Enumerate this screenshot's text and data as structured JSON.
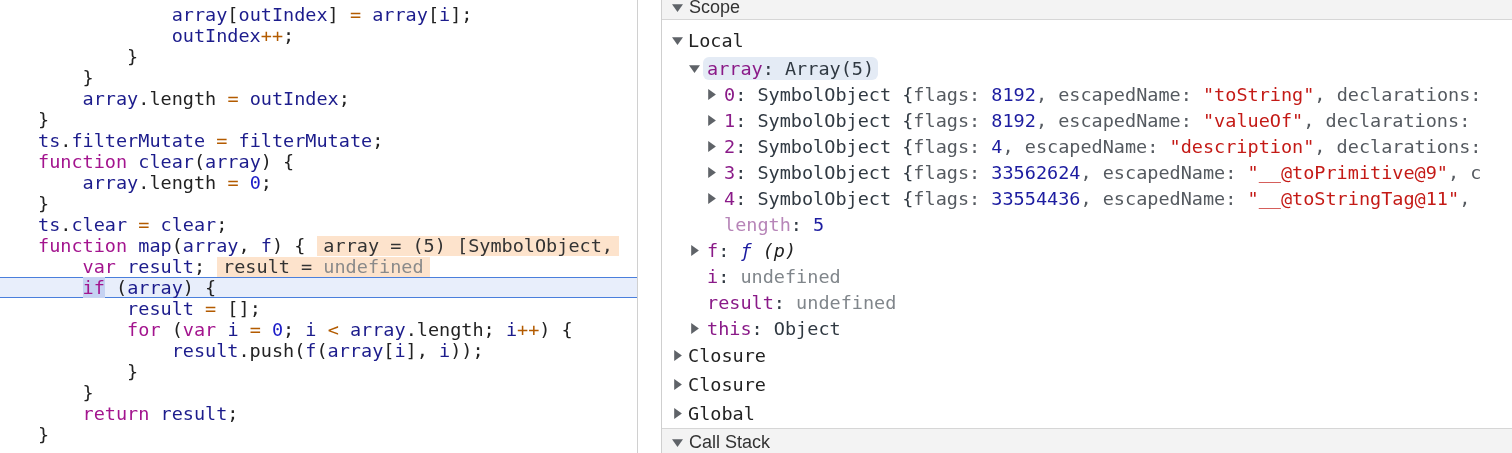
{
  "editor": {
    "lines": [
      {
        "current": false,
        "tokens": [
          {
            "kind": "var",
            "text": "            array"
          },
          {
            "kind": "punct",
            "text": "["
          },
          {
            "kind": "var",
            "text": "outIndex"
          },
          {
            "kind": "punct",
            "text": "] "
          },
          {
            "kind": "op",
            "text": "="
          },
          {
            "kind": "var",
            "text": " array"
          },
          {
            "kind": "punct",
            "text": "["
          },
          {
            "kind": "var",
            "text": "i"
          },
          {
            "kind": "punct",
            "text": "];"
          }
        ]
      },
      {
        "current": false,
        "tokens": [
          {
            "kind": "var",
            "text": "            outIndex"
          },
          {
            "kind": "op",
            "text": "++"
          },
          {
            "kind": "punct",
            "text": ";"
          }
        ]
      },
      {
        "current": false,
        "tokens": [
          {
            "kind": "punct",
            "text": "        }"
          }
        ]
      },
      {
        "current": false,
        "tokens": [
          {
            "kind": "punct",
            "text": "    }"
          }
        ]
      },
      {
        "current": false,
        "tokens": [
          {
            "kind": "var",
            "text": "    array"
          },
          {
            "kind": "punct",
            "text": ".length "
          },
          {
            "kind": "op",
            "text": "="
          },
          {
            "kind": "var",
            "text": " outIndex"
          },
          {
            "kind": "punct",
            "text": ";"
          }
        ]
      },
      {
        "current": false,
        "tokens": [
          {
            "kind": "punct",
            "text": "}"
          }
        ]
      },
      {
        "current": false,
        "tokens": [
          {
            "kind": "var",
            "text": "ts"
          },
          {
            "kind": "punct",
            "text": "."
          },
          {
            "kind": "var",
            "text": "filterMutate "
          },
          {
            "kind": "op",
            "text": "="
          },
          {
            "kind": "var",
            "text": " filterMutate"
          },
          {
            "kind": "punct",
            "text": ";"
          }
        ]
      },
      {
        "current": false,
        "tokens": [
          {
            "kind": "keyword",
            "text": "function"
          },
          {
            "kind": "var",
            "text": " clear"
          },
          {
            "kind": "punct",
            "text": "("
          },
          {
            "kind": "var",
            "text": "array"
          },
          {
            "kind": "punct",
            "text": ") {"
          }
        ]
      },
      {
        "current": false,
        "tokens": [
          {
            "kind": "var",
            "text": "    array"
          },
          {
            "kind": "punct",
            "text": ".length "
          },
          {
            "kind": "op",
            "text": "="
          },
          {
            "kind": "number",
            "text": " 0"
          },
          {
            "kind": "punct",
            "text": ";"
          }
        ]
      },
      {
        "current": false,
        "tokens": [
          {
            "kind": "punct",
            "text": "}"
          }
        ]
      },
      {
        "current": false,
        "tokens": [
          {
            "kind": "var",
            "text": "ts"
          },
          {
            "kind": "punct",
            "text": "."
          },
          {
            "kind": "var",
            "text": "clear "
          },
          {
            "kind": "op",
            "text": "="
          },
          {
            "kind": "var",
            "text": " clear"
          },
          {
            "kind": "punct",
            "text": ";"
          }
        ]
      },
      {
        "current": false,
        "tokens": [
          {
            "kind": "keyword",
            "text": "function"
          },
          {
            "kind": "var",
            "text": " map"
          },
          {
            "kind": "punct",
            "text": "("
          },
          {
            "kind": "var",
            "text": "array"
          },
          {
            "kind": "punct",
            "text": ", "
          },
          {
            "kind": "var",
            "text": "f"
          },
          {
            "kind": "punct",
            "text": ") {"
          }
        ],
        "annotation": [
          {
            "kind": "punct",
            "text": "array = (5) [SymbolObject,"
          }
        ]
      },
      {
        "current": false,
        "tokens": [
          {
            "kind": "keyword",
            "text": "    var"
          },
          {
            "kind": "var",
            "text": " result"
          },
          {
            "kind": "punct",
            "text": ";"
          }
        ],
        "annotation": [
          {
            "kind": "punct",
            "text": "result = "
          },
          {
            "kind": "undefined",
            "text": "undefined"
          }
        ]
      },
      {
        "current": true,
        "tokens": [
          {
            "kind": "paused_keyword",
            "text": "    if"
          },
          {
            "kind": "punct",
            "text": " ("
          },
          {
            "kind": "var",
            "text": "array"
          },
          {
            "kind": "punct",
            "text": ") {"
          }
        ]
      },
      {
        "current": false,
        "tokens": [
          {
            "kind": "var",
            "text": "        result "
          },
          {
            "kind": "op",
            "text": "="
          },
          {
            "kind": "punct",
            "text": " [];"
          }
        ]
      },
      {
        "current": false,
        "tokens": [
          {
            "kind": "keyword",
            "text": "        for"
          },
          {
            "kind": "punct",
            "text": " ("
          },
          {
            "kind": "keyword",
            "text": "var"
          },
          {
            "kind": "var",
            "text": " i "
          },
          {
            "kind": "op",
            "text": "="
          },
          {
            "kind": "number",
            "text": " 0"
          },
          {
            "kind": "punct",
            "text": "; "
          },
          {
            "kind": "var",
            "text": "i "
          },
          {
            "kind": "op",
            "text": "<"
          },
          {
            "kind": "var",
            "text": " array"
          },
          {
            "kind": "punct",
            "text": ".length; "
          },
          {
            "kind": "var",
            "text": "i"
          },
          {
            "kind": "op",
            "text": "++"
          },
          {
            "kind": "punct",
            "text": ") {"
          }
        ]
      },
      {
        "current": false,
        "tokens": [
          {
            "kind": "var",
            "text": "            result"
          },
          {
            "kind": "punct",
            "text": ".push("
          },
          {
            "kind": "var",
            "text": "f"
          },
          {
            "kind": "punct",
            "text": "("
          },
          {
            "kind": "var",
            "text": "array"
          },
          {
            "kind": "punct",
            "text": "["
          },
          {
            "kind": "var",
            "text": "i"
          },
          {
            "kind": "punct",
            "text": "], "
          },
          {
            "kind": "var",
            "text": "i"
          },
          {
            "kind": "punct",
            "text": "));"
          }
        ]
      },
      {
        "current": false,
        "tokens": [
          {
            "kind": "punct",
            "text": "        }"
          }
        ]
      },
      {
        "current": false,
        "tokens": [
          {
            "kind": "punct",
            "text": "    }"
          }
        ]
      },
      {
        "current": false,
        "tokens": [
          {
            "kind": "keyword",
            "text": "    return"
          },
          {
            "kind": "var",
            "text": " result"
          },
          {
            "kind": "punct",
            "text": ";"
          }
        ]
      },
      {
        "current": false,
        "tokens": [
          {
            "kind": "punct",
            "text": "}"
          }
        ]
      }
    ]
  },
  "scope_panel": {
    "title": "Scope",
    "expanded": true,
    "items": [
      {
        "kind": "scope",
        "name": "Local",
        "expanded": true,
        "children": [
          {
            "kind": "property",
            "name": "array",
            "value": [
              {
                "kind": "text",
                "text": ": Array(5)"
              }
            ],
            "expanded": true,
            "selected": true,
            "dimmed": false,
            "children": [
              {
                "kind": "property",
                "name": "0",
                "value": [
                  {
                    "kind": "text",
                    "text": ": SymbolObject {"
                  },
                  {
                    "kind": "key",
                    "text": "flags: "
                  },
                  {
                    "kind": "number",
                    "text": "8192"
                  },
                  {
                    "kind": "key",
                    "text": ", escapedName: "
                  },
                  {
                    "kind": "string",
                    "text": "\"toString\""
                  },
                  {
                    "kind": "key",
                    "text": ", declarations:"
                  }
                ],
                "expanded": false,
                "selected": false,
                "dimmed": false
              },
              {
                "kind": "property",
                "name": "1",
                "value": [
                  {
                    "kind": "text",
                    "text": ": SymbolObject {"
                  },
                  {
                    "kind": "key",
                    "text": "flags: "
                  },
                  {
                    "kind": "number",
                    "text": "8192"
                  },
                  {
                    "kind": "key",
                    "text": ", escapedName: "
                  },
                  {
                    "kind": "string",
                    "text": "\"valueOf\""
                  },
                  {
                    "kind": "key",
                    "text": ", declarations:"
                  }
                ],
                "expanded": false,
                "selected": false,
                "dimmed": false
              },
              {
                "kind": "property",
                "name": "2",
                "value": [
                  {
                    "kind": "text",
                    "text": ": SymbolObject {"
                  },
                  {
                    "kind": "key",
                    "text": "flags: "
                  },
                  {
                    "kind": "number",
                    "text": "4"
                  },
                  {
                    "kind": "key",
                    "text": ", escapedName: "
                  },
                  {
                    "kind": "string",
                    "text": "\"description\""
                  },
                  {
                    "kind": "key",
                    "text": ", declarations:"
                  }
                ],
                "expanded": false,
                "selected": false,
                "dimmed": false
              },
              {
                "kind": "property",
                "name": "3",
                "value": [
                  {
                    "kind": "text",
                    "text": ": SymbolObject {"
                  },
                  {
                    "kind": "key",
                    "text": "flags: "
                  },
                  {
                    "kind": "number",
                    "text": "33562624"
                  },
                  {
                    "kind": "key",
                    "text": ", escapedName: "
                  },
                  {
                    "kind": "string",
                    "text": "\"__@toPrimitive@9\""
                  },
                  {
                    "kind": "key",
                    "text": ", c"
                  }
                ],
                "expanded": false,
                "selected": false,
                "dimmed": false
              },
              {
                "kind": "property",
                "name": "4",
                "value": [
                  {
                    "kind": "text",
                    "text": ": SymbolObject {"
                  },
                  {
                    "kind": "key",
                    "text": "flags: "
                  },
                  {
                    "kind": "number",
                    "text": "33554436"
                  },
                  {
                    "kind": "key",
                    "text": ", escapedName: "
                  },
                  {
                    "kind": "string",
                    "text": "\"__@toStringTag@11\""
                  },
                  {
                    "kind": "key",
                    "text": ","
                  }
                ],
                "expanded": false,
                "selected": false,
                "dimmed": false
              },
              {
                "kind": "leaf",
                "name": "length",
                "value": [
                  {
                    "kind": "text",
                    "text": ": "
                  },
                  {
                    "kind": "number",
                    "text": "5"
                  }
                ],
                "selected": false,
                "dimmed": true
              }
            ]
          },
          {
            "kind": "property",
            "name": "f",
            "value": [
              {
                "kind": "text",
                "text": ": "
              },
              {
                "kind": "func",
                "text": "ƒ"
              },
              {
                "kind": "italic",
                "text": " (p)"
              }
            ],
            "expanded": false,
            "selected": false,
            "dimmed": false
          },
          {
            "kind": "leaf",
            "name": "i",
            "value": [
              {
                "kind": "text",
                "text": ": "
              },
              {
                "kind": "undefined",
                "text": "undefined"
              }
            ],
            "selected": false,
            "dimmed": false
          },
          {
            "kind": "leaf",
            "name": "result",
            "value": [
              {
                "kind": "text",
                "text": ": "
              },
              {
                "kind": "undefined",
                "text": "undefined"
              }
            ],
            "selected": false,
            "dimmed": false
          },
          {
            "kind": "property",
            "name": "this",
            "value": [
              {
                "kind": "text",
                "text": ": Object"
              }
            ],
            "expanded": false,
            "selected": false,
            "dimmed": false
          }
        ]
      },
      {
        "kind": "scope",
        "name": "Closure",
        "expanded": false
      },
      {
        "kind": "scope",
        "name": "Closure",
        "expanded": false
      },
      {
        "kind": "scope",
        "name": "Global",
        "expanded": false
      }
    ]
  },
  "call_stack_panel": {
    "title": "Call Stack",
    "expanded": true
  }
}
